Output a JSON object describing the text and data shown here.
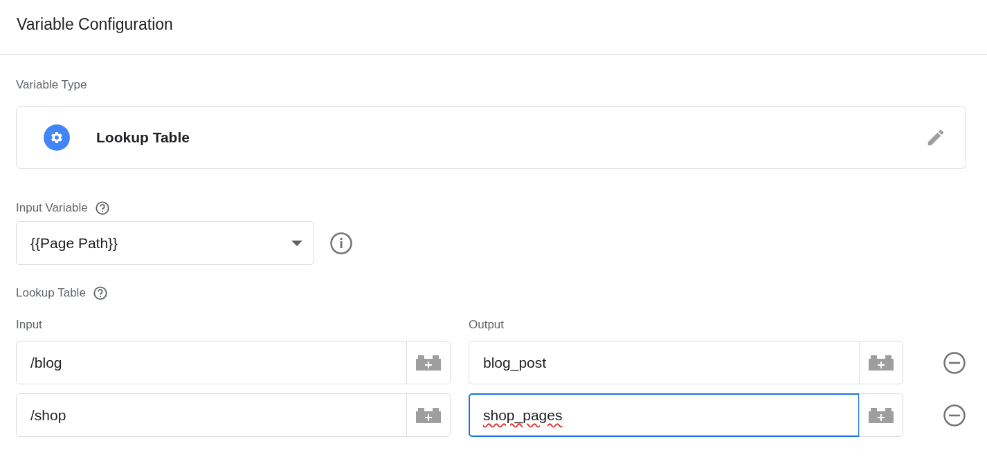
{
  "header": {
    "title": "Variable Configuration"
  },
  "variable_type": {
    "label": "Variable Type",
    "name": "Lookup Table"
  },
  "input_variable": {
    "label": "Input Variable",
    "value": "{{Page Path}}"
  },
  "lookup_table": {
    "label": "Lookup Table",
    "columns": [
      "Input",
      "Output"
    ],
    "rows": [
      {
        "input": {
          "value": "/blog",
          "focused": false,
          "misspelled": false
        },
        "output": {
          "value": "blog_post",
          "focused": false,
          "misspelled": false
        }
      },
      {
        "input": {
          "value": "/shop",
          "focused": false,
          "misspelled": false
        },
        "output": {
          "value": "shop_pages",
          "focused": true,
          "misspelled": true
        }
      }
    ]
  }
}
